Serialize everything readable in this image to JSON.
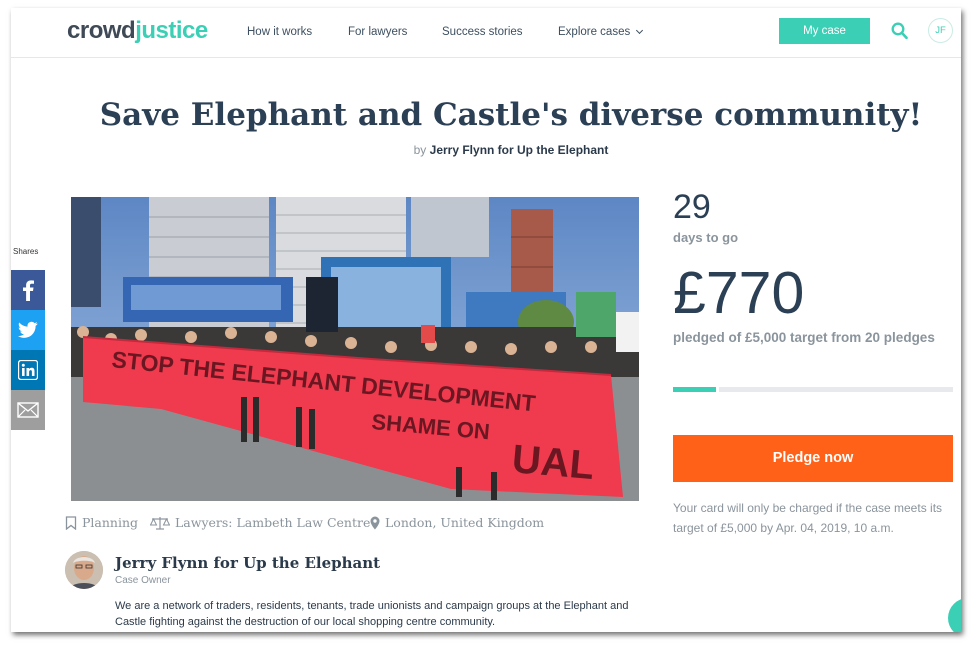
{
  "header": {
    "logo_part1": "crowd",
    "logo_part2": "justice",
    "nav": [
      "How it works",
      "For lawyers",
      "Success stories",
      "Explore cases"
    ],
    "my_case": "My case",
    "user_initials": "JF"
  },
  "case": {
    "title": "Save Elephant and Castle's diverse community!",
    "by_prefix": "by",
    "author": "Jerry Flynn for Up the Elephant"
  },
  "share": {
    "label": "Shares",
    "buttons": [
      {
        "icon": "facebook-icon",
        "color": "#3b5998"
      },
      {
        "icon": "twitter-icon",
        "color": "#1da1f2"
      },
      {
        "icon": "linkedin-icon",
        "color": "#0077b5"
      },
      {
        "icon": "email-icon",
        "color": "#9e9e9e"
      }
    ]
  },
  "photo": {
    "banner_text": "STOP THE ELEPHANT DEVELOPMENT",
    "banner_text2": "SHAME ON",
    "banner_text3": "UAL"
  },
  "meta": {
    "stage": "Planning",
    "lawyers": "Lawyers: Lambeth Law Centre",
    "location": "London, United Kingdom"
  },
  "owner": {
    "name": "Jerry Flynn for Up the Elephant",
    "role": "Case Owner",
    "about": "We are a network of traders, residents, tenants, trade unionists and campaign groups at the Elephant and Castle fighting against the destruction of our local shopping centre community."
  },
  "stats": {
    "days": "29",
    "days_label": "days to go",
    "amount": "£770",
    "pledged_label": "pledged of £5,000 target from 20 pledges",
    "progress_fraction": 0.154,
    "pledge_button": "Pledge now",
    "charge_note": "Your card will only be charged if the case meets its target of £5,000 by Apr. 04, 2019, 10 a.m."
  },
  "colors": {
    "accent": "#3bcfb5",
    "pledge": "#ff6118",
    "heading": "#2b3f55"
  }
}
